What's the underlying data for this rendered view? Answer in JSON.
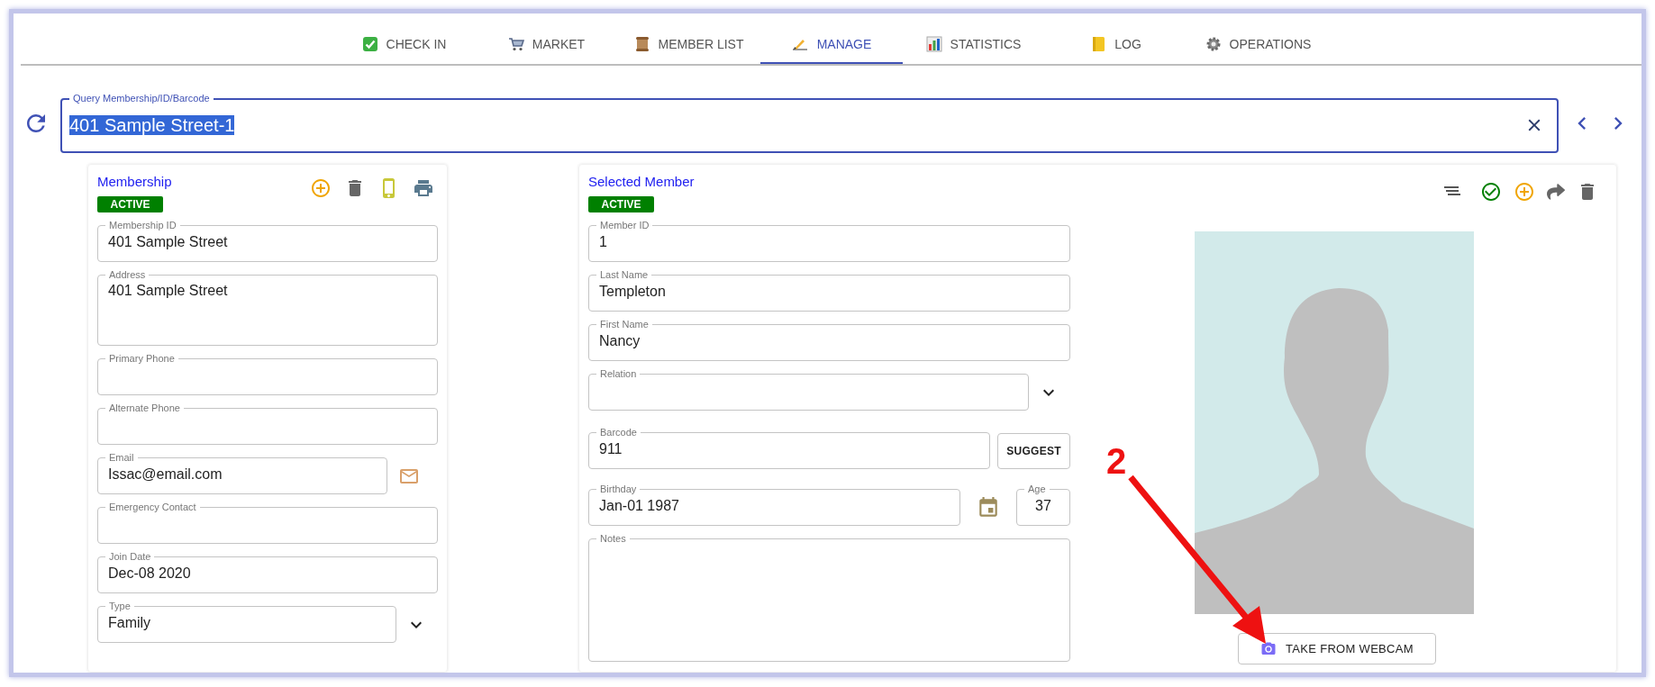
{
  "tabs": [
    {
      "label": "CHECK IN",
      "selected": false
    },
    {
      "label": "MARKET",
      "selected": false
    },
    {
      "label": "MEMBER LIST",
      "selected": false
    },
    {
      "label": "MANAGE",
      "selected": true
    },
    {
      "label": "STATISTICS",
      "selected": false
    },
    {
      "label": "LOG",
      "selected": false
    },
    {
      "label": "OPERATIONS",
      "selected": false
    }
  ],
  "query": {
    "label": "Query Membership/ID/Barcode",
    "value": "401 Sample Street-1",
    "highlighted": true
  },
  "membership": {
    "title": "Membership",
    "status": "ACTIVE",
    "fields": [
      {
        "kind": "text",
        "label": "Membership ID",
        "value": "401 Sample Street"
      },
      {
        "kind": "textarea",
        "label": "Address",
        "value": "401 Sample Street"
      },
      {
        "kind": "text",
        "label": "Primary Phone"
      },
      {
        "kind": "text",
        "label": "Alternate Phone"
      },
      {
        "kind": "email",
        "label": "Email",
        "value": "Issac@email.com"
      },
      {
        "kind": "text",
        "label": "Emergency Contact"
      },
      {
        "kind": "text",
        "label": "Join Date",
        "value": "Dec-08 2020"
      },
      {
        "kind": "select",
        "label": "Type",
        "value": "Family"
      }
    ]
  },
  "member": {
    "title": "Selected Member",
    "status": "ACTIVE",
    "fields": [
      {
        "kind": "text",
        "label": "Member ID",
        "value": "1"
      },
      {
        "kind": "text",
        "label": "Last Name",
        "value": "Templeton"
      },
      {
        "kind": "text",
        "label": "First Name",
        "value": "Nancy"
      },
      {
        "kind": "select",
        "label": "Relation"
      },
      {
        "kind": "button",
        "label": "Barcode",
        "value": "911",
        "button": "SUGGEST"
      },
      {
        "kind": "date",
        "label": "Birthday",
        "value": "Jan-01 1987",
        "age": {
          "label": "Age",
          "value": "37"
        }
      },
      {
        "kind": "notes",
        "label": "Notes"
      }
    ],
    "photo": {
      "kind": "picture",
      "button": "TAKE FROM WEBCAM"
    }
  },
  "annotation": {
    "number": "2"
  }
}
